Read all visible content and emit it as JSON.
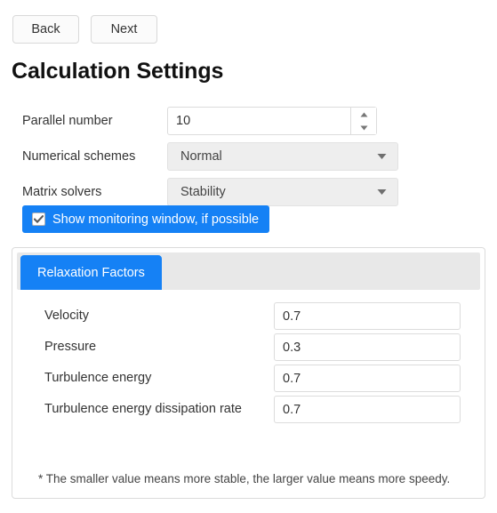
{
  "nav": {
    "back_label": "Back",
    "next_label": "Next"
  },
  "page_title": "Calculation Settings",
  "settings": {
    "parallel_number": {
      "label": "Parallel number",
      "value": "10"
    },
    "numerical_schemes": {
      "label": "Numerical schemes",
      "value": "Normal"
    },
    "matrix_solvers": {
      "label": "Matrix solvers",
      "value": "Stability"
    },
    "monitoring": {
      "label": "Show monitoring window, if possible",
      "checked": true,
      "check_glyph": "✔"
    }
  },
  "panel": {
    "tabs": [
      {
        "label": "Relaxation Factors",
        "active": true
      }
    ],
    "fields": [
      {
        "label": "Velocity",
        "value": "0.7"
      },
      {
        "label": "Pressure",
        "value": "0.3"
      },
      {
        "label": "Turbulence energy",
        "value": "0.7"
      },
      {
        "label": "Turbulence energy dissipation rate",
        "value": "0.7"
      }
    ],
    "note": "* The smaller value means more stable, the larger value means more speedy."
  },
  "colors": {
    "accent": "#1581f5",
    "panel_border": "#dbdbdb",
    "tabbar_bg": "#e8e8e8",
    "select_bg": "#eeeeee",
    "text": "#333333"
  }
}
